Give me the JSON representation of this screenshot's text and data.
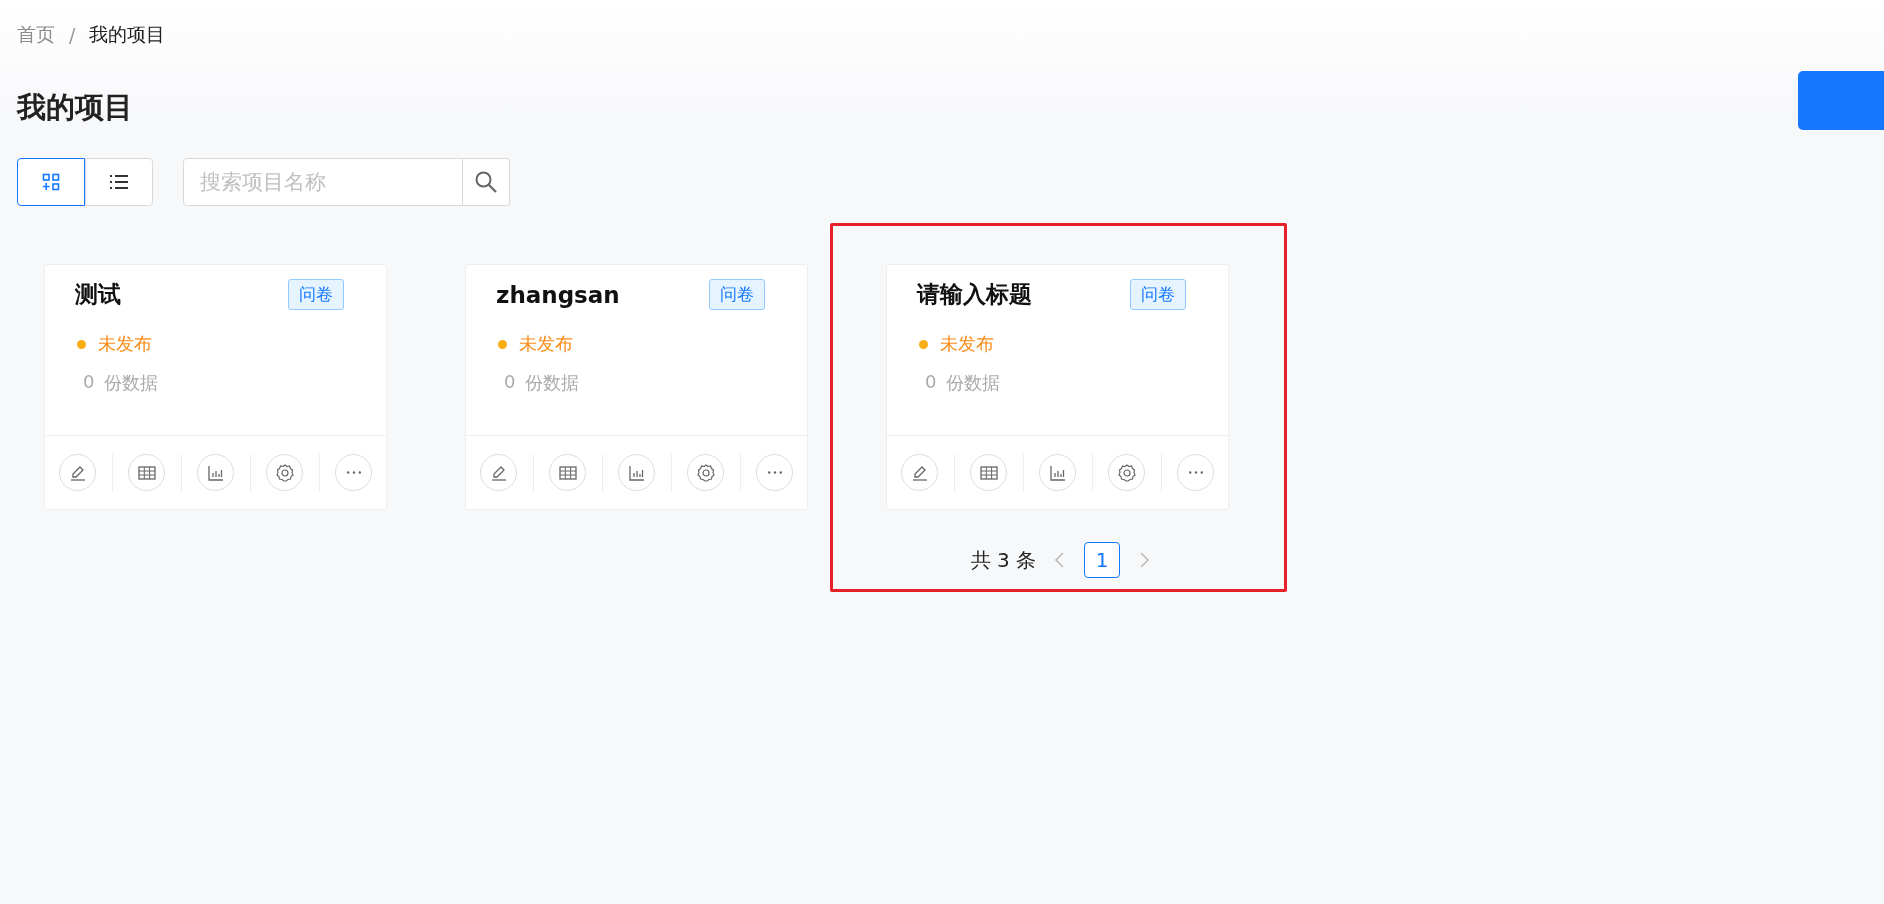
{
  "breadcrumb": {
    "items": [
      {
        "label": "首页",
        "current": false
      },
      {
        "label": "我的项目",
        "current": true
      }
    ],
    "separator": "/"
  },
  "page_title": "我的项目",
  "view_toggle": [
    {
      "kind": "grid",
      "selected": true
    },
    {
      "kind": "list",
      "selected": false
    }
  ],
  "search": {
    "placeholder": "搜索项目名称"
  },
  "projects": [
    {
      "title": "测试",
      "tag": "问卷",
      "status": "未发布",
      "published": false,
      "count": "0",
      "count_unit": "份数据"
    },
    {
      "title": "zhangsan",
      "tag": "问卷",
      "status": "未发布",
      "published": false,
      "count": "0",
      "count_unit": "份数据"
    },
    {
      "title": "请输入标题",
      "tag": "问卷",
      "status": "未发布",
      "published": false,
      "count": "0",
      "count_unit": "份数据"
    }
  ],
  "pagination": {
    "total": "共 3 条",
    "pages": [
      {
        "label": "1",
        "selected": true
      }
    ]
  }
}
